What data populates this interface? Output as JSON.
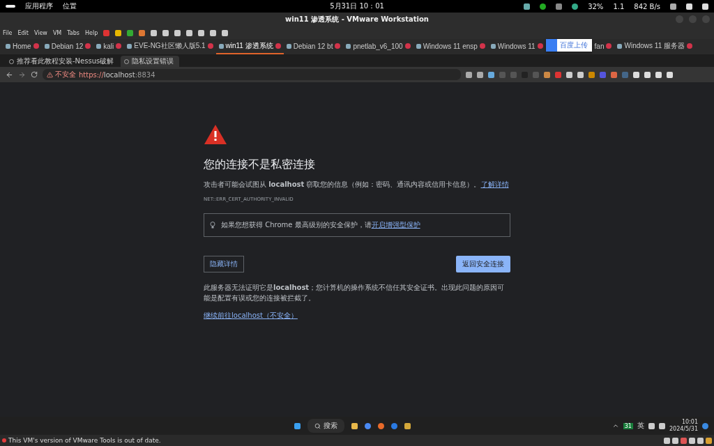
{
  "top_bar": {
    "menus": [
      "应用程序",
      "位置"
    ],
    "clock": "5月31日 10：01",
    "battery": "32%",
    "display": "1.1",
    "network_speed": "842 B/s"
  },
  "window": {
    "title": "win11 渗透系统 - VMware Workstation"
  },
  "menu_bar": [
    "File",
    "Edit",
    "View",
    "VM",
    "Tabs",
    "Help"
  ],
  "vm_tabs": [
    {
      "label": "Home",
      "selected": false
    },
    {
      "label": "Debian 12",
      "selected": false
    },
    {
      "label": "kali",
      "selected": false
    },
    {
      "label": "EVE-NG社区懒人版5.1",
      "selected": false
    },
    {
      "label": "win11 渗透系统",
      "selected": true
    },
    {
      "label": "Debian 12 bt",
      "selected": false
    },
    {
      "label": "pnetlab_v6_100",
      "selected": false
    },
    {
      "label": "Windows 11 ensp",
      "selected": false
    },
    {
      "label": "Windows 11",
      "selected": false
    },
    {
      "label": "fan",
      "selected": false
    },
    {
      "label": "Windows 11 服务器",
      "selected": false
    }
  ],
  "upload_popup": {
    "label": "百度上传"
  },
  "browser_tabs": [
    {
      "label": "推荐看此教程安装-Nessus破解",
      "selected": false
    },
    {
      "label": "隐私设置错误",
      "selected": true
    }
  ],
  "address_bar": {
    "security": "不安全",
    "scheme": "https://",
    "host": "localhost",
    "port": ":8834"
  },
  "error_page": {
    "heading": "您的连接不是私密连接",
    "message": "攻击者可能会试图从 **localhost** 窃取您的信息（例如：密码、通讯内容或信用卡信息）。",
    "learn_more": "了解详情",
    "error_code": "NET::ERR_CERT_AUTHORITY_INVALID",
    "tip": "如果您想获得 Chrome 最高级别的安全保护，请",
    "tip_link": "开启增强型保护",
    "details_button": "隐藏详情",
    "back_button": "返回安全连接",
    "details": "此服务器无法证明它是**localhost**；您计算机的操作系统不信任其安全证书。出现此问题的原因可能是配置有误或您的连接被拦截了。",
    "proceed_link": "继续前往localhost（不安全）"
  },
  "taskbar": {
    "search": "搜索",
    "ime_badge": "31",
    "ime": "英",
    "time": "10:01",
    "date": "2024/5/31"
  },
  "status_bar": {
    "message": "This VM's version of VMware Tools is out of date."
  }
}
